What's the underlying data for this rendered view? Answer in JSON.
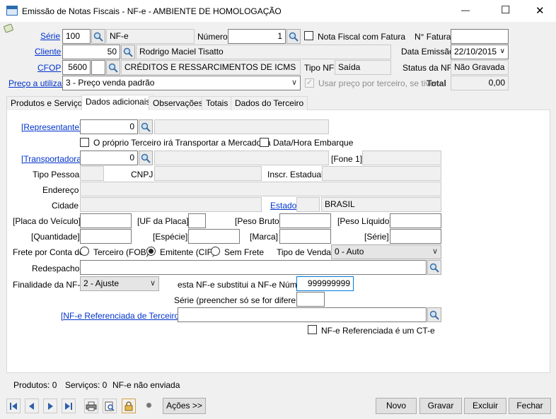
{
  "window": {
    "title": "Emissão de Notas Fiscais - NF-e - AMBIENTE DE HOMOLOGAÇÃO",
    "min": "—",
    "max": "☐",
    "close": "✕"
  },
  "header": {
    "serie_label": "Série",
    "serie_value": "100",
    "serie_desc": "NF-e",
    "numero_label": "Número",
    "numero_value": "1",
    "fatura_check_label": "Nota Fiscal com Fatura",
    "nfatura_label": "N° Fatura",
    "nfatura_value": "",
    "cliente_label": "Cliente",
    "cliente_code": "50",
    "cliente_name": "Rodrigo Maciel Tisatto",
    "data_emissao_label": "Data Emissão",
    "data_emissao_value": "22/10/2015",
    "cfop_label": "CFOP",
    "cfop_code": "5600",
    "cfop_desc": "CRÉDITOS E RESSARCIMENTOS DE ICMS",
    "tipo_nf_label": "Tipo NF",
    "tipo_nf_value": "Saída",
    "status_label": "Status da NF",
    "status_value": "Não Gravada",
    "preco_label": "Preço a utilizar",
    "preco_value": "3 - Preço venda padrão",
    "usar_preco_label": "Usar preço por terceiro, se tiver",
    "total_label": "Total",
    "total_value": "0,00"
  },
  "tabs": [
    "Produtos e Serviços",
    "Dados adicionais",
    "Observações",
    "Totais",
    "Dados do Terceiro"
  ],
  "form": {
    "representante_label": "[Representante]",
    "representante_code": "0",
    "proprio_terceiro_label": "O próprio Terceiro irá Transportar a Mercadoria",
    "data_hora_label": "Data/Hora Embarque",
    "transportadora_label": "[Transportadora]",
    "transportadora_code": "0",
    "fone_label": "[Fone 1]",
    "tipo_pessoa_label": "Tipo Pessoa",
    "cnpj_label": "CNPJ",
    "inscr_label": "Inscr. Estadual",
    "endereco_label": "Endereço",
    "cidade_label": "Cidade",
    "estado_label": "Estado",
    "pais_value": "BRASIL",
    "placa_label": "[Placa do Veículo]",
    "uf_placa_label": "[UF da Placa]",
    "peso_bruto_label": "[Peso Bruto]",
    "peso_liquido_label": "[Peso Líquido]",
    "quantidade_label": "[Quantidade]",
    "especie_label": "[Espécie]",
    "marca_label": "[Marca]",
    "serie_label": "[Série]",
    "frete_label": "Frete por Conta do",
    "frete_fob": "Terceiro (FOB)",
    "frete_cif": "Emitente (CIF)",
    "frete_sem": "Sem Frete",
    "tipo_venda_label": "Tipo de Venda",
    "tipo_venda_value": "0 - Auto",
    "redespacho_label": "Redespacho",
    "finalidade_label": "Finalidade da NF-e",
    "finalidade_value": "2 - Ajuste",
    "substitui_label": "esta NF-e substitui a NF-e Número",
    "substitui_value": "999999999",
    "serie_diff_label": "Série (preencher só se for diferente)",
    "referenciada_label": "[NF-e Referenciada de Terceiros]",
    "cte_label": "NF-e Referenciada é um CT-e"
  },
  "status_bar": {
    "produtos": "Produtos: 0",
    "servicos": "Serviços: 0",
    "envio": "NF-e não enviada"
  },
  "buttons": {
    "acoes": "Ações >>",
    "novo": "Novo",
    "gravar": "Gravar",
    "excluir": "Excluir",
    "fechar": "Fechar"
  }
}
